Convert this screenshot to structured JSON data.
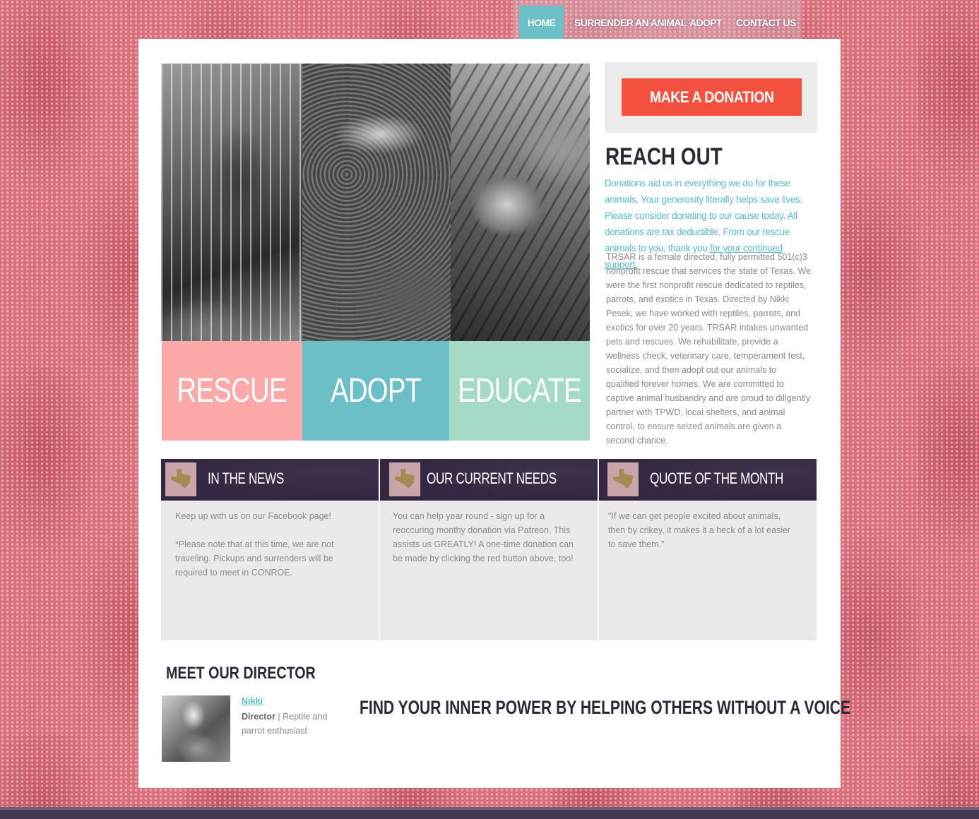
{
  "nav": {
    "items": [
      "HOME",
      "SURRENDER AN ANIMAL",
      "ADOPT",
      "CONTACT US"
    ],
    "active": "HOME"
  },
  "hero": {
    "tiles": [
      {
        "label": "RESCUE",
        "color": "#fda8a9"
      },
      {
        "label": "ADOPT",
        "color": "#6dbfc7"
      },
      {
        "label": "EDUCATE",
        "color": "#a5dbc6"
      }
    ]
  },
  "donate": {
    "button_label": "MAKE A DONATION",
    "button_color": "#f45040"
  },
  "reach_out": {
    "title": "REACH OUT",
    "intro": "Donations aid us in everything we do for these animals. Your generosity literally helps save lives. Please consider donating to our cause today. All donations are tax deductible. From our rescue animals to you, thank you ",
    "intro_link": "for your continued support.",
    "body": "TRSAR is a female directed, fully permitted 501(c)3 nonprofit rescue that services the state of Texas. We were the first nonprofit rescue dedicated to reptiles, parrots, and exotics in Texas. Directed by Nikki Pesek, we have worked with reptiles, parrots, and exotics for over 20 years. TRSAR intakes unwanted pets and rescues. We rehabilitate, provide a wellness check, veterinary care, temperament test, socialize, and then adopt out our animals to qualified forever homes. We are committed to captive animal husbandry and are proud to diligently partner with TPWD, local shelters, and animal control, to ensure seized animals are given a second chance."
  },
  "columns": [
    {
      "title": "IN THE NEWS",
      "icon": "texas-icon",
      "paragraphs": [
        "Keep up with us on our Facebook page!",
        "*Please note that at this time, we are not traveling. Pickups and surrenders will be required to meet in CONROE."
      ]
    },
    {
      "title": "OUR CURRENT NEEDS",
      "icon": "texas-icon",
      "paragraphs": [
        "You can help year round - sign up for a reoccuring monthy donation via Patreon. This assists us GREATLY! A one-time donation can be made by clicking the red button above, too!"
      ]
    },
    {
      "title": "QUOTE OF THE MONTH",
      "icon": "texas-icon",
      "paragraphs": [
        "\"If we can get people excited about animals, then by crikey, it makes it a heck of a lot easier to save them.\""
      ]
    }
  ],
  "director": {
    "section_title": "MEET OUR DIRECTOR",
    "name": "Nikki",
    "role_bold": "Director",
    "role_rest": " | Reptile and parrot enthusiast"
  },
  "slogan": "FIND YOUR INNER POWER BY HELPING OTHERS WITHOUT A VOICE",
  "colors": {
    "accent_teal": "#5bbcc7",
    "dark_purple": "#332742",
    "background_snakeskin": "#d9707c"
  }
}
